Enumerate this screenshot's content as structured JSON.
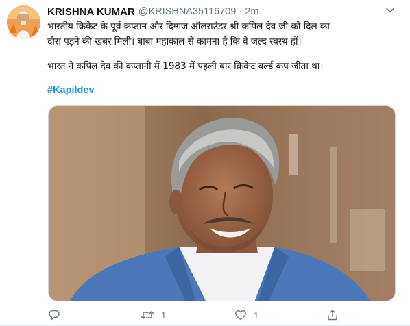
{
  "tweet": {
    "author_name": "KRISHNA KUMAR",
    "author_handle": "@KRISHNA35116709",
    "separator": "·",
    "time": "2m",
    "lines": [
      "भारतीय क्रिकेट के पूर्व कप्तान और दिग्गज ऑलराउंडर श्री कपिल देव जी को दिल का",
      "दौरा पड़ने की खबर मिली। बाबा महाकाल से कामना है कि वे जल्द स्वस्थ हों।",
      "भारत ने कपिल देव की कप्तानी में 1983 में पहली बार क्रिकेट वर्ल्ड कप जीता था।"
    ],
    "hashtag": "#Kapildev",
    "reply_count": "",
    "retweet_count": "1",
    "like_count": "1"
  },
  "icons": {
    "avatar": "profile-photo",
    "more": "chevron-down-icon",
    "reply": "reply-icon",
    "retweet": "retweet-icon",
    "like": "heart-icon",
    "share": "share-icon"
  },
  "colors": {
    "text": "#14171a",
    "secondary": "#657786",
    "link": "#1b95e0",
    "border": "#ccd6dd"
  }
}
